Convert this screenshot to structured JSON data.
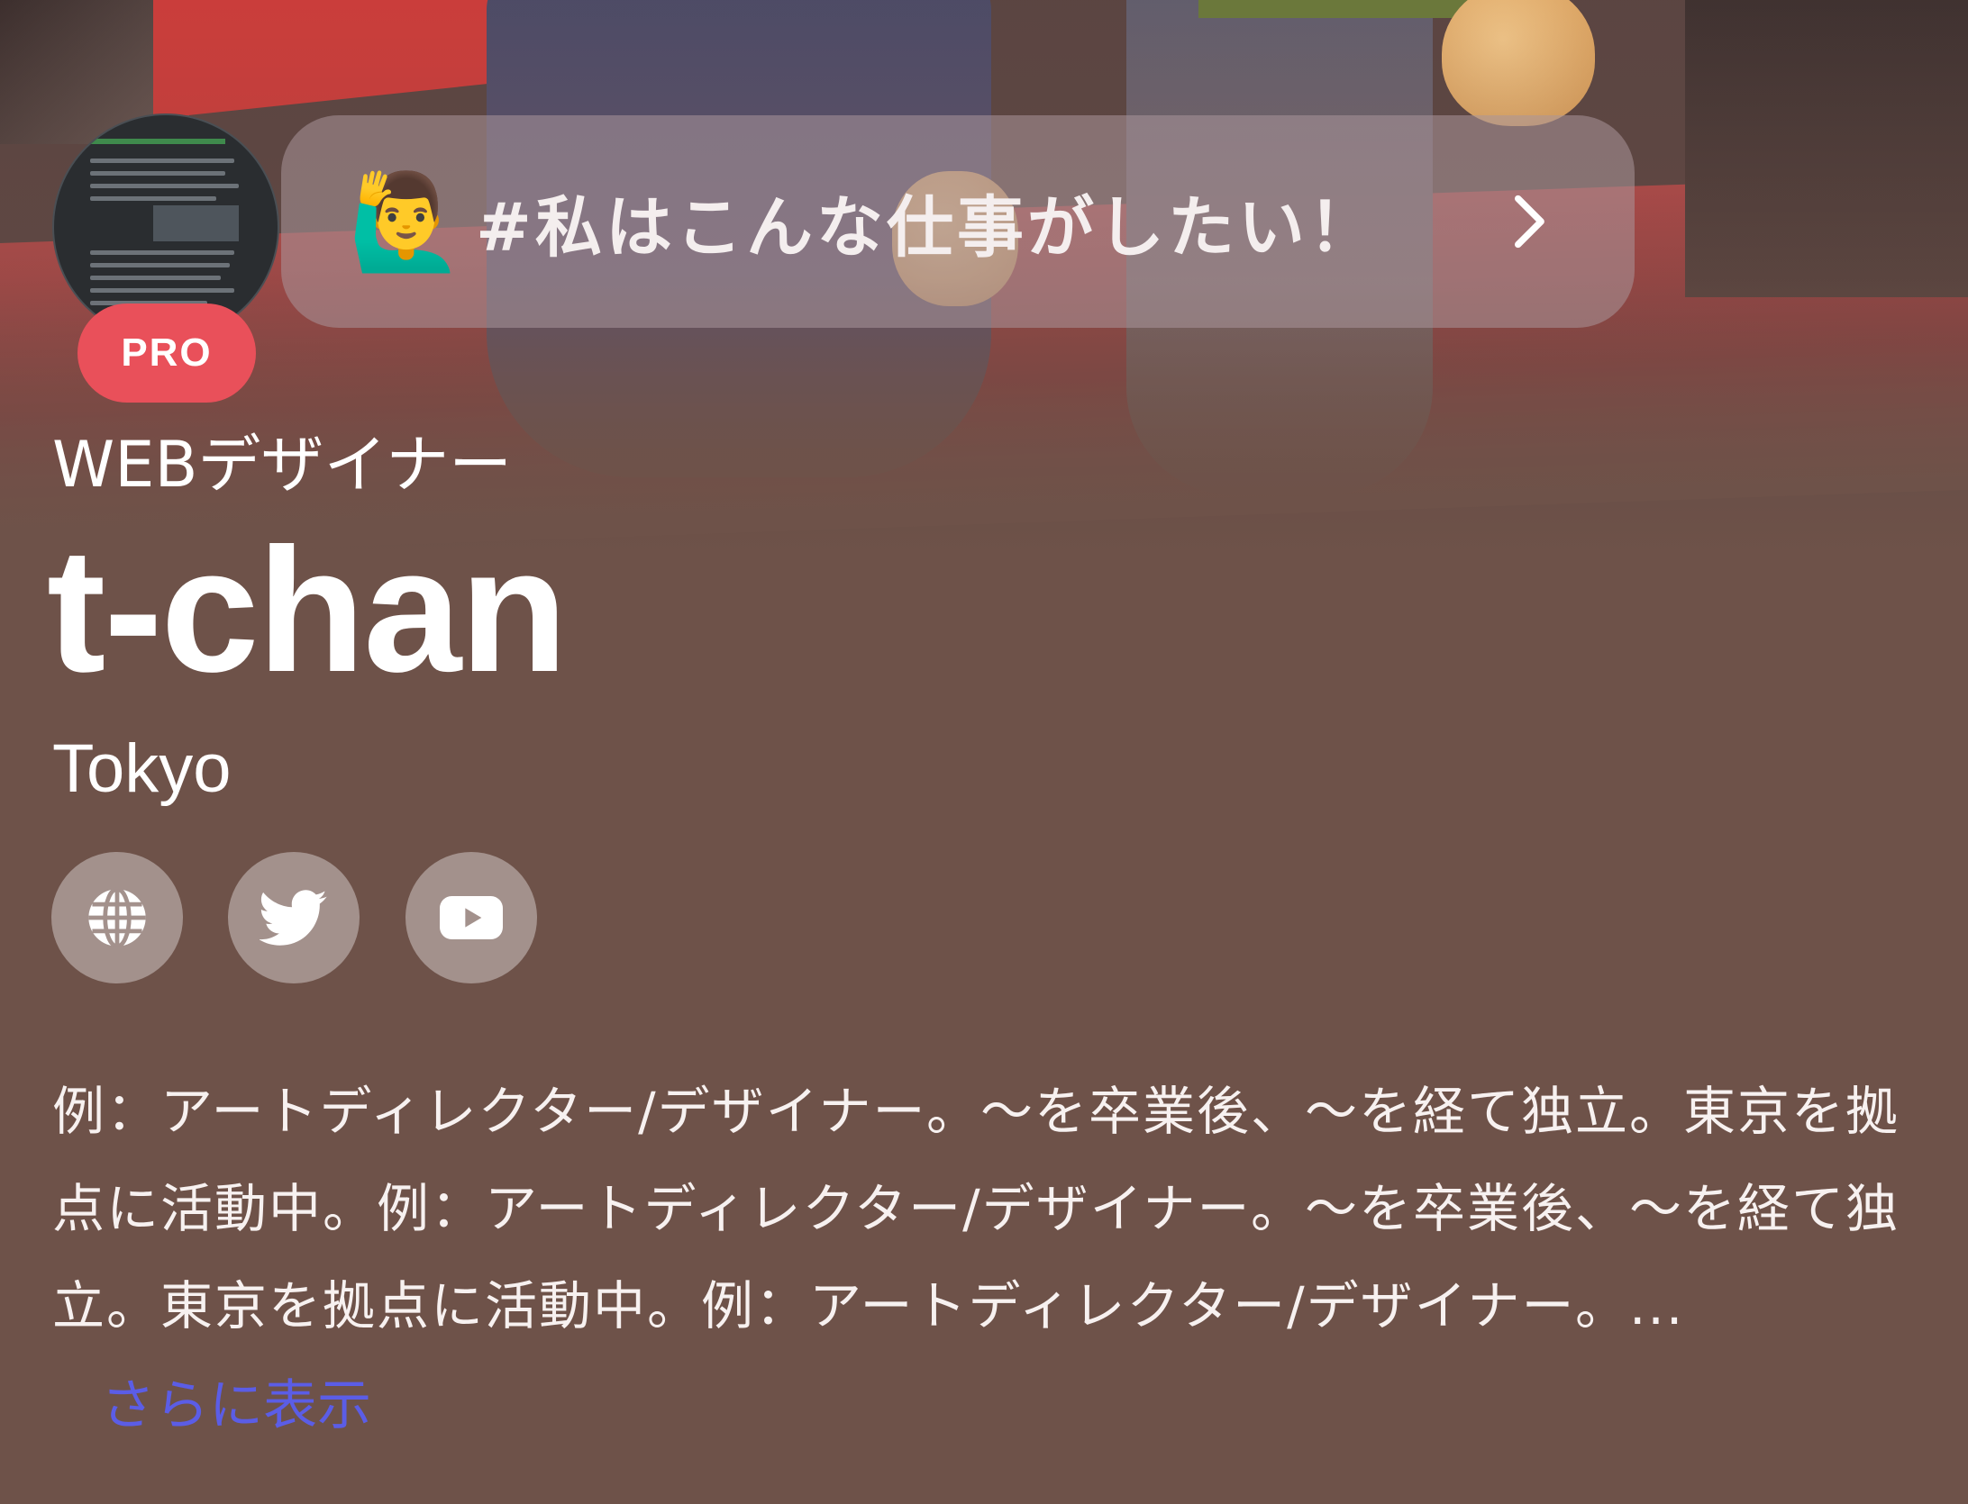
{
  "hashtag": {
    "emoji": "🙋‍♂️",
    "label": "#私はこんな仕事がしたい！"
  },
  "profile": {
    "badge": "PRO",
    "role": "WEBデザイナー",
    "name": "t-chan",
    "location": "Tokyo"
  },
  "social": [
    {
      "icon": "globe-icon"
    },
    {
      "icon": "twitter-icon"
    },
    {
      "icon": "youtube-icon"
    }
  ],
  "bio": {
    "text": "例：アートディレクター/デザイナー。〜を卒業後、〜を経て独立。東京を拠点に活動中。例：アートディレクター/デザイナー。〜を卒業後、〜を経て独立。東京を拠点に活動中。例：アートディレクター/デザイナー。...",
    "show_more": "さらに表示"
  },
  "colors": {
    "background": "#6e5249",
    "pro_badge": "#e9505a",
    "link": "#5b5de6",
    "social_button": "#a3918c"
  }
}
